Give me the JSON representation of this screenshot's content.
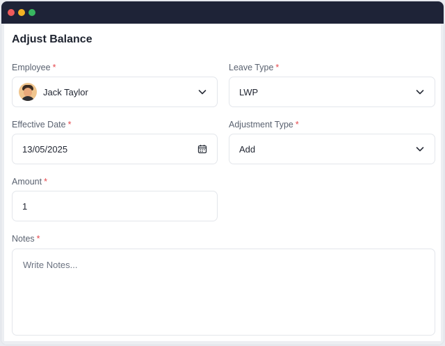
{
  "window": {
    "controls": [
      "close",
      "minimize",
      "maximize"
    ]
  },
  "form": {
    "title": "Adjust Balance",
    "employee": {
      "label": "Employee",
      "required": "*",
      "value": "Jack Taylor",
      "icon": "chevron-down-icon"
    },
    "leave_type": {
      "label": "Leave Type",
      "required": "*",
      "value": "LWP",
      "icon": "chevron-down-icon"
    },
    "effective_date": {
      "label": "Effective Date",
      "required": "*",
      "value": "13/05/2025",
      "icon": "calendar-icon"
    },
    "adjustment_type": {
      "label": "Adjustment Type",
      "required": "*",
      "value": "Add",
      "icon": "chevron-down-icon"
    },
    "amount": {
      "label": "Amount",
      "required": "*",
      "value": "1"
    },
    "notes": {
      "label": "Notes",
      "required": "*",
      "placeholder": "Write Notes..."
    }
  },
  "colors": {
    "titlebar": "#1e2337",
    "required": "#e5484d",
    "border": "#e3e6eb"
  }
}
